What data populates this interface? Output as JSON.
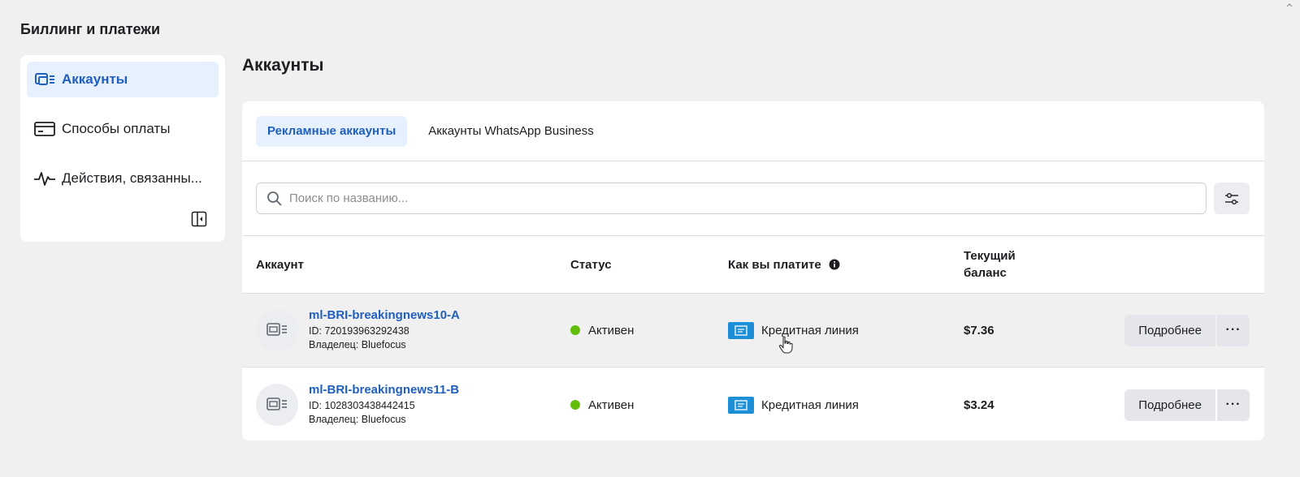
{
  "page": {
    "title": "Биллинг и платежи"
  },
  "sidebar": {
    "items": [
      {
        "label": "Аккаунты",
        "icon": "accounts-icon",
        "active": true
      },
      {
        "label": "Способы оплаты",
        "icon": "credit-card-icon",
        "active": false
      },
      {
        "label": "Действия, связанны...",
        "icon": "activity-icon",
        "active": false
      }
    ]
  },
  "main": {
    "title": "Аккаунты",
    "tabs": [
      {
        "label": "Рекламные аккаунты",
        "active": true
      },
      {
        "label": "Аккаунты WhatsApp Business",
        "active": false
      }
    ],
    "search": {
      "placeholder": "Поиск по названию..."
    },
    "table": {
      "headers": {
        "account": "Аккаунт",
        "status": "Статус",
        "pay": "Как вы платите",
        "balance": "Текущий баланс"
      },
      "rows": [
        {
          "name": "ml-BRI-breakingnews10-A",
          "id": "ID: 720193963292438",
          "owner": "Владелец: Bluefocus",
          "status": "Активен",
          "pay": "Кредитная линия",
          "balance": "$7.36",
          "details": "Подробнее",
          "more": "···"
        },
        {
          "name": "ml-BRI-breakingnews11-B",
          "id": "ID: 1028303438442415",
          "owner": "Владелец: Bluefocus",
          "status": "Активен",
          "pay": "Кредитная линия",
          "balance": "$3.24",
          "details": "Подробнее",
          "more": "···"
        }
      ]
    }
  },
  "colors": {
    "accent": "#1f5fbf",
    "active_bg": "#e7f0fd",
    "status_active": "#63be09",
    "pay_icon": "#1d8fd6"
  }
}
